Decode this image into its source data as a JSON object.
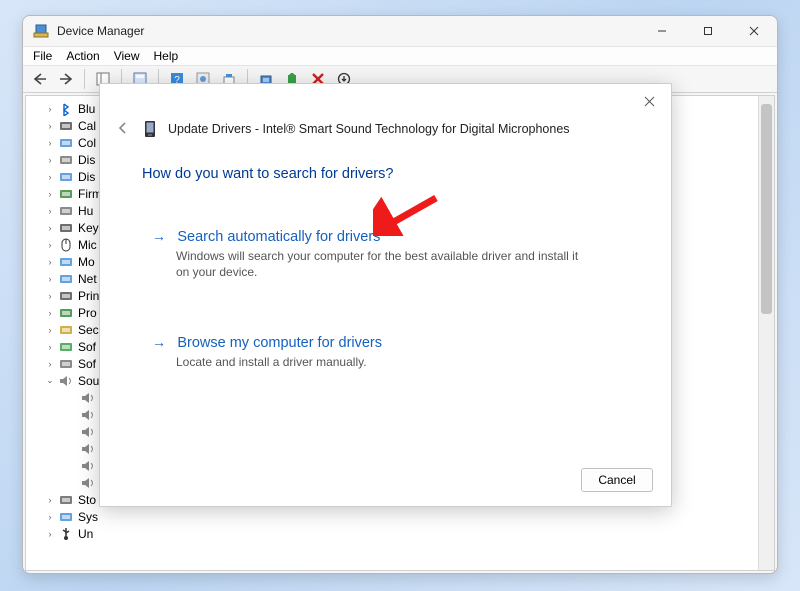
{
  "window": {
    "title": "Device Manager",
    "menus": [
      "File",
      "Action",
      "View",
      "Help"
    ]
  },
  "tree": [
    {
      "label": "Blu",
      "icon": "bluetooth",
      "twisty": ">",
      "indent": 1
    },
    {
      "label": "Cal",
      "icon": "camera",
      "twisty": ">",
      "indent": 1
    },
    {
      "label": "Col",
      "icon": "computer",
      "twisty": ">",
      "indent": 1
    },
    {
      "label": "Dis",
      "icon": "disk",
      "twisty": ">",
      "indent": 1
    },
    {
      "label": "Dis",
      "icon": "display",
      "twisty": ">",
      "indent": 1
    },
    {
      "label": "Firm",
      "icon": "chip",
      "twisty": ">",
      "indent": 1
    },
    {
      "label": "Hu",
      "icon": "hid",
      "twisty": ">",
      "indent": 1
    },
    {
      "label": "Key",
      "icon": "keyboard",
      "twisty": ">",
      "indent": 1
    },
    {
      "label": "Mic",
      "icon": "mouse",
      "twisty": ">",
      "indent": 1
    },
    {
      "label": "Mo",
      "icon": "monitor",
      "twisty": ">",
      "indent": 1
    },
    {
      "label": "Net",
      "icon": "network",
      "twisty": ">",
      "indent": 1
    },
    {
      "label": "Prin",
      "icon": "printer",
      "twisty": ">",
      "indent": 1
    },
    {
      "label": "Pro",
      "icon": "cpu",
      "twisty": ">",
      "indent": 1
    },
    {
      "label": "Sec",
      "icon": "security",
      "twisty": ">",
      "indent": 1
    },
    {
      "label": "Sof",
      "icon": "component",
      "twisty": ">",
      "indent": 1
    },
    {
      "label": "Sof",
      "icon": "software",
      "twisty": ">",
      "indent": 1
    },
    {
      "label": "Sou",
      "icon": "sound",
      "twisty": "v",
      "indent": 1
    },
    {
      "label": "",
      "icon": "audio",
      "twisty": "",
      "indent": 2
    },
    {
      "label": "",
      "icon": "audio",
      "twisty": "",
      "indent": 2
    },
    {
      "label": "",
      "icon": "audio",
      "twisty": "",
      "indent": 2
    },
    {
      "label": "",
      "icon": "audio",
      "twisty": "",
      "indent": 2
    },
    {
      "label": "",
      "icon": "audio",
      "twisty": "",
      "indent": 2
    },
    {
      "label": "",
      "icon": "audio",
      "twisty": "",
      "indent": 2
    },
    {
      "label": "Sto",
      "icon": "storage",
      "twisty": ">",
      "indent": 1
    },
    {
      "label": "Sys",
      "icon": "system",
      "twisty": ">",
      "indent": 1
    },
    {
      "label": "Un",
      "icon": "usb",
      "twisty": ">",
      "indent": 1
    }
  ],
  "dialog": {
    "title": "Update Drivers - Intel® Smart Sound Technology for Digital Microphones",
    "question": "How do you want to search for drivers?",
    "options": [
      {
        "title": "Search automatically for drivers",
        "desc": "Windows will search your computer for the best available driver and install it on your device."
      },
      {
        "title": "Browse my computer for drivers",
        "desc": "Locate and install a driver manually."
      }
    ],
    "cancel": "Cancel"
  }
}
